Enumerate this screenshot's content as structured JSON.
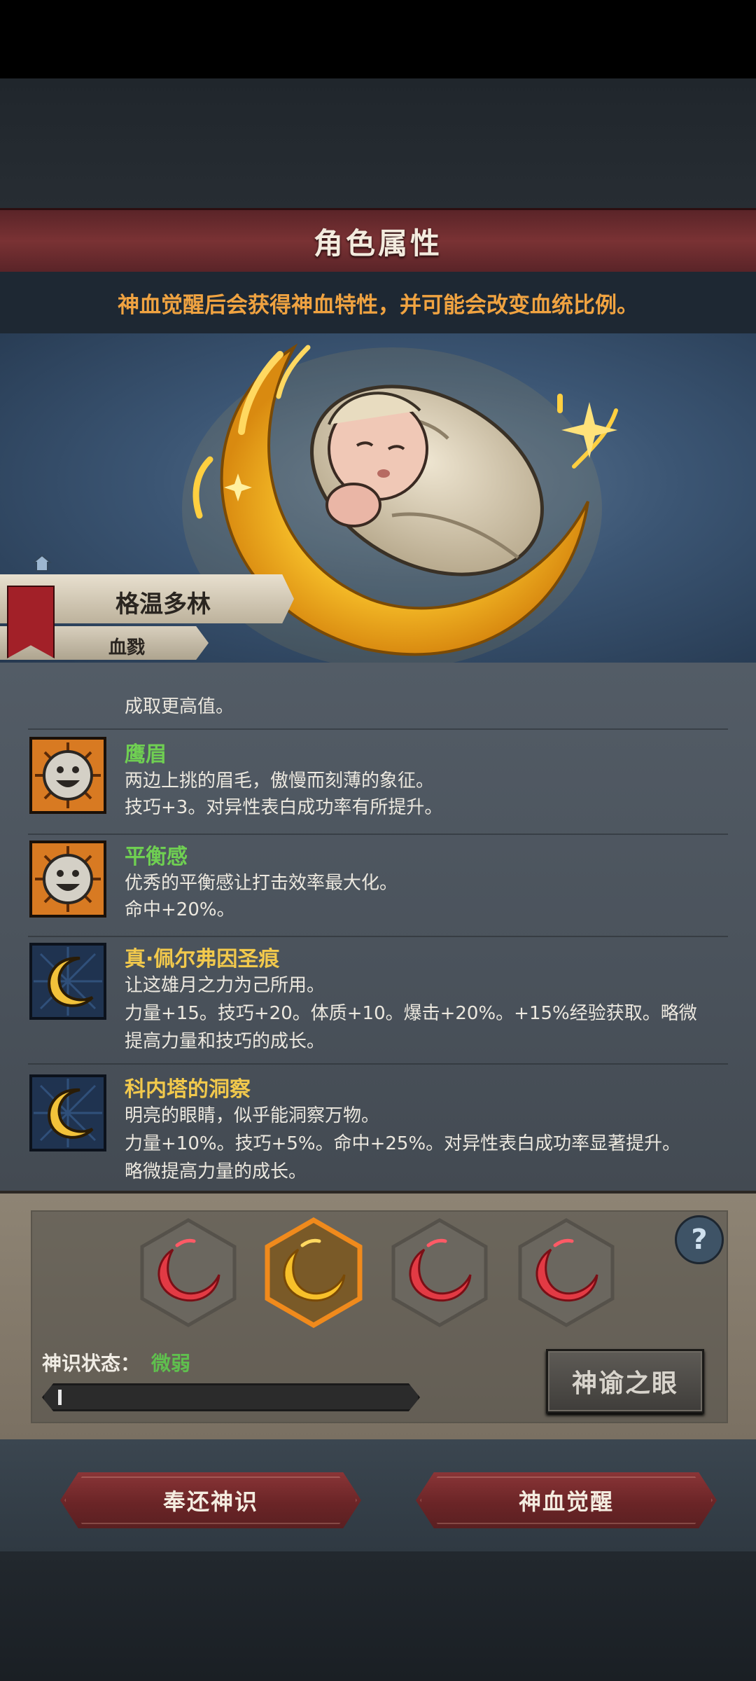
{
  "header": {
    "title": "角色属性"
  },
  "notice": "神血觉醒后会获得神血特性，并可能会改变血统比例。",
  "character": {
    "name": "格温多林",
    "title": "血戮"
  },
  "traits": {
    "partial_line": "成取更高值。",
    "items": [
      {
        "name": "鹰眉",
        "name_color": "#6fcf52",
        "icon": "smiley-face-icon",
        "lines": [
          "两边上挑的眉毛，傲慢而刻薄的象征。",
          "技巧+3。对异性表白成功率有所提升。"
        ]
      },
      {
        "name": "平衡感",
        "name_color": "#6fcf52",
        "icon": "smiley-face-icon",
        "lines": [
          "优秀的平衡感让打击效率最大化。",
          "命中+20%。"
        ]
      },
      {
        "name": "真·佩尔弗因圣痕",
        "name_color": "#f2c94c",
        "icon": "crescent-moon-icon",
        "lines": [
          "让这雄月之力为己所用。",
          "力量+15。技巧+20。体质+10。爆击+20%。+15%经验获取。略微",
          "提高力量和技巧的成长。"
        ]
      },
      {
        "name": "科内塔的洞察",
        "name_color": "#f2c94c",
        "icon": "crescent-moon-icon",
        "lines": [
          "明亮的眼睛，似乎能洞察万物。",
          "力量+10%。技巧+5%。命中+25%。对异性表白成功率显著提升。",
          "略微提高力量的成长。"
        ]
      }
    ]
  },
  "awakening": {
    "slots": [
      "red",
      "gold",
      "red",
      "red"
    ],
    "help_label": "?",
    "status_label": "神识状态：",
    "status_value": "微弱",
    "progress": 0.01,
    "oracle_button": "神谕之眼"
  },
  "buttons": {
    "return_label": "奉还神识",
    "awaken_label": "神血觉醒"
  },
  "colors": {
    "accent_red": "#7a3234",
    "status_green": "#5fc04e",
    "gold": "#f2c94c"
  }
}
